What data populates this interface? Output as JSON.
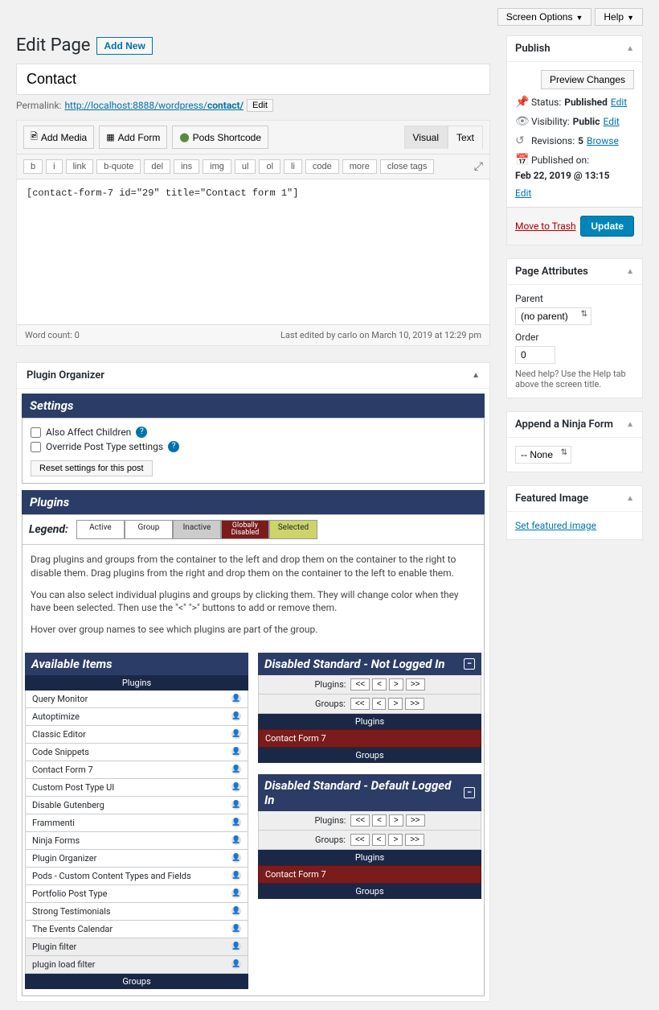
{
  "topbar": {
    "screen_options": "Screen Options",
    "help": "Help"
  },
  "heading": {
    "title": "Edit Page",
    "add_new": "Add New"
  },
  "post": {
    "title": "Contact",
    "permalink_label": "Permalink:",
    "permalink_base": "http://localhost:8888/wordpress/",
    "permalink_slug": "contact/",
    "permalink_edit": "Edit",
    "content": "[contact-form-7 id=\"29\" title=\"Contact form 1\"]",
    "word_count_label": "Word count: 0",
    "last_edited": "Last edited by carlo on March 10, 2019 at 12:29 pm"
  },
  "media": {
    "add_media": "Add Media",
    "add_form": "Add Form",
    "pods_shortcode": "Pods Shortcode",
    "tab_visual": "Visual",
    "tab_text": "Text"
  },
  "toolbar": [
    "b",
    "i",
    "link",
    "b-quote",
    "del",
    "ins",
    "img",
    "ul",
    "ol",
    "li",
    "code",
    "more",
    "close tags"
  ],
  "plugin_organizer": {
    "box_title": "Plugin Organizer",
    "settings_head": "Settings",
    "affect_children": "Also Affect Children",
    "override_post_type": "Override Post Type settings",
    "reset_btn": "Reset settings for this post",
    "plugins_head": "Plugins",
    "legend_label": "Legend:",
    "legend": {
      "active": "Active",
      "group": "Group",
      "inactive": "Inactive",
      "globally_disabled": "Globally Disabled",
      "selected": "Selected"
    },
    "instr1": "Drag plugins and groups from the container to the left and drop them on the container to the right to disable them. Drag plugins from the right and drop them on the container to the left to enable them.",
    "instr2": "You can also select individual plugins and groups by clicking them. They will change color when they have been selected. Then use the \"<\" \">\" buttons to add or remove them.",
    "instr3": "Hover over group names to see which plugins are part of the group.",
    "available_head": "Available Items",
    "plugins_sub": "Plugins",
    "groups_sub": "Groups",
    "available_plugins": [
      "Query Monitor",
      "Autoptimize",
      "Classic Editor",
      "Code Snippets",
      "Contact Form 7",
      "Custom Post Type UI",
      "Disable Gutenberg",
      "Frammenti",
      "Ninja Forms",
      "Plugin Organizer",
      "Pods - Custom Content Types and Fields",
      "Portfolio Post Type",
      "Strong Testimonials",
      "The Events Calendar",
      "Plugin filter",
      "plugin load filter"
    ],
    "disabled_nl_head": "Disabled Standard - Not Logged In",
    "disabled_dl_head": "Disabled Standard - Default Logged In",
    "shift_plugins": "Plugins:",
    "shift_groups": "Groups:",
    "shift_btns": [
      "<<",
      "<",
      ">",
      ">>"
    ],
    "disabled_item": "Contact Form 7"
  },
  "publish": {
    "title": "Publish",
    "preview": "Preview Changes",
    "status_label": "Status:",
    "status_val": "Published",
    "edit": "Edit",
    "visibility_label": "Visibility:",
    "visibility_val": "Public",
    "revisions_label": "Revisions:",
    "revisions_val": "5",
    "browse": "Browse",
    "published_label": "Published on:",
    "published_val": "Feb 22, 2019 @ 13:15",
    "trash": "Move to Trash",
    "update": "Update"
  },
  "page_attributes": {
    "title": "Page Attributes",
    "parent_label": "Parent",
    "parent_value": "(no parent)",
    "order_label": "Order",
    "order_value": "0",
    "note": "Need help? Use the Help tab above the screen title."
  },
  "ninja": {
    "title": "Append a Ninja Form",
    "value": "-- None"
  },
  "featured": {
    "title": "Featured Image",
    "link": "Set featured image"
  }
}
